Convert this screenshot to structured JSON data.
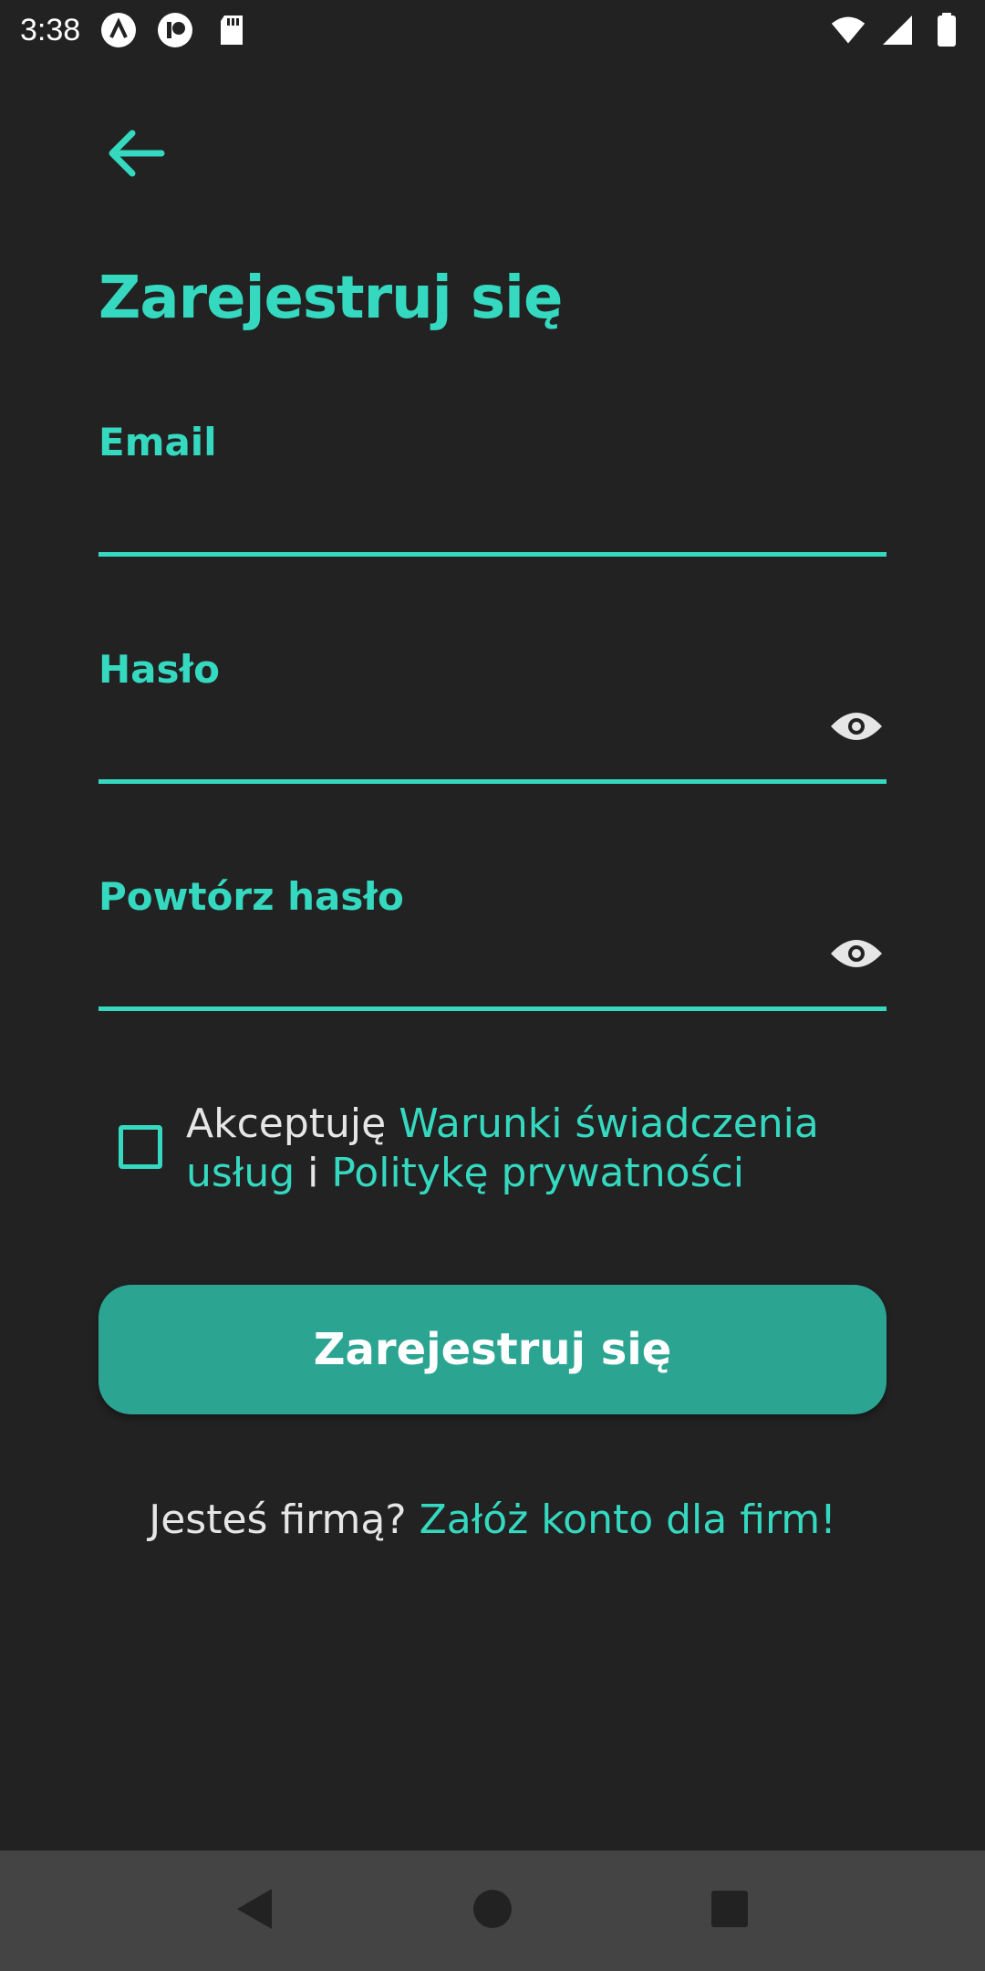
{
  "status_bar": {
    "time": "3:38",
    "left_icons": [
      "app-a-icon",
      "app-p-icon",
      "sd-card-icon"
    ],
    "right_icons": [
      "wifi-icon",
      "signal-icon",
      "battery-icon"
    ]
  },
  "header": {
    "back_icon": "arrow-left-icon",
    "title": "Zarejestruj się"
  },
  "form": {
    "email": {
      "label": "Email",
      "value": ""
    },
    "password": {
      "label": "Hasło",
      "value": "",
      "icon": "eye-icon"
    },
    "repeat_password": {
      "label": "Powtórz hasło",
      "value": "",
      "icon": "eye-icon"
    }
  },
  "terms": {
    "checked": false,
    "prefix": "Akceptuję ",
    "terms_link": "Warunki świadczenia usług",
    "connector": " i ",
    "privacy_link": "Politykę prywatności"
  },
  "submit": {
    "label": "Zarejestruj się"
  },
  "company": {
    "question": "Jesteś firmą? ",
    "link": "Załóż konto dla firm!"
  },
  "nav": {
    "back": "back-triangle-icon",
    "home": "home-circle-icon",
    "recents": "recents-square-icon"
  },
  "colors": {
    "accent": "#34d9c0",
    "button": "#2ba592",
    "background": "#222222",
    "navbar": "#444444"
  }
}
